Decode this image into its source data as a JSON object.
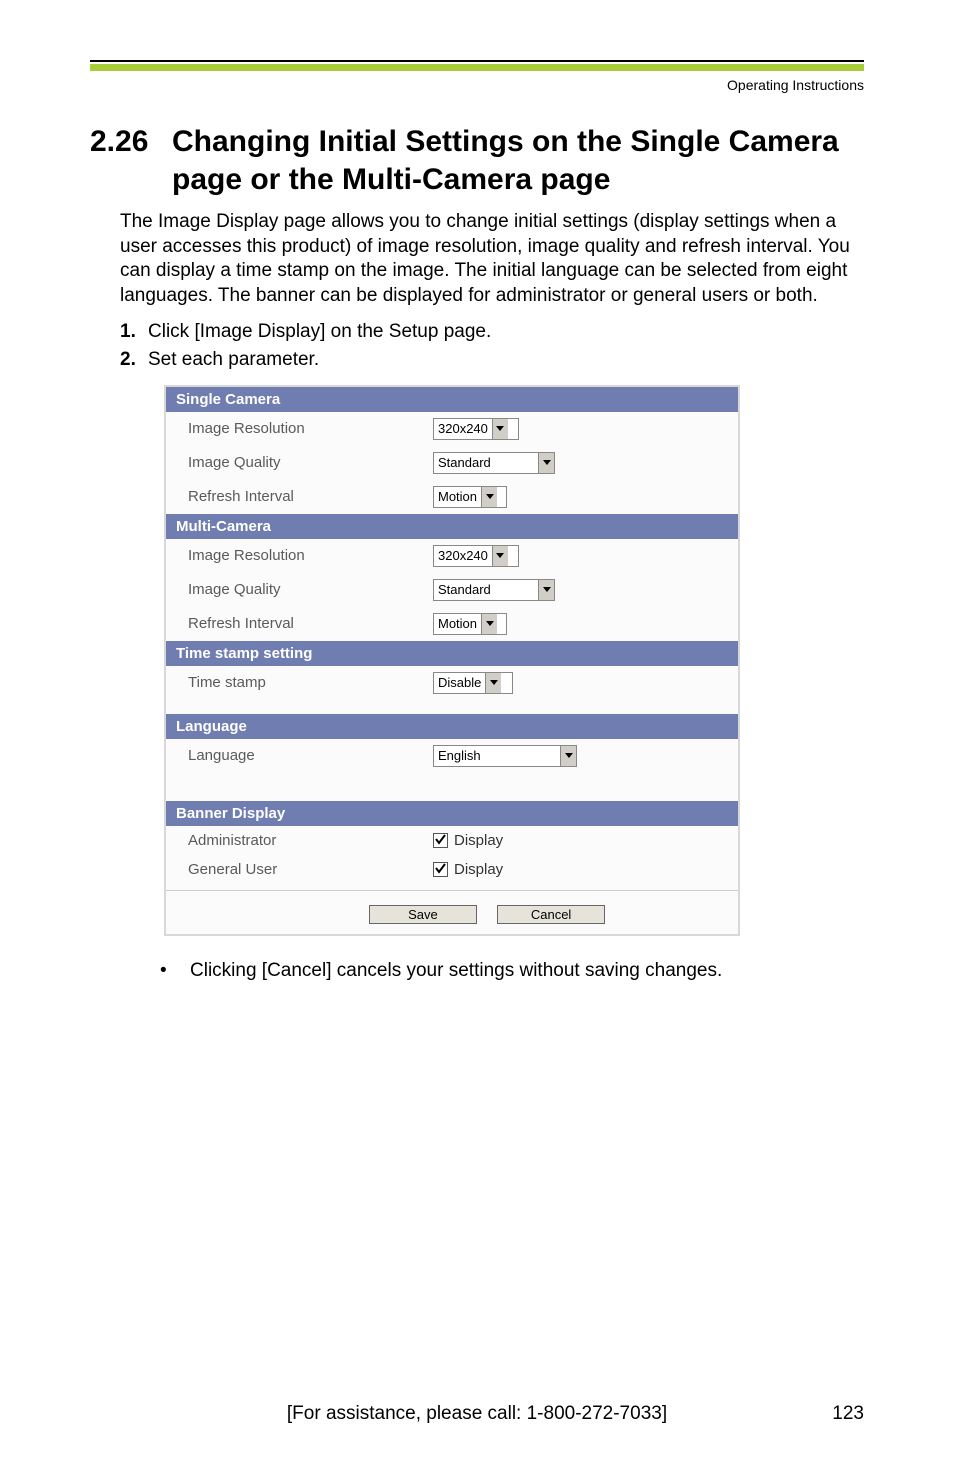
{
  "header": {
    "doc_title": "Operating Instructions"
  },
  "heading": {
    "number": "2.26",
    "title": "Changing Initial Settings on the Single Camera page or the Multi-Camera page"
  },
  "intro": "The Image Display page allows you to change initial settings (display settings when a user accesses this product) of image resolution, image quality and refresh interval. You can display a time stamp on the image. The initial language can be selected from eight languages. The banner can be displayed for administrator or general users or both.",
  "steps": {
    "s1": {
      "num": "1.",
      "text": "Click [Image Display] on the Setup page."
    },
    "s2": {
      "num": "2.",
      "text": "Set each parameter."
    }
  },
  "form": {
    "single_camera": {
      "header": "Single Camera",
      "image_resolution": {
        "label": "Image Resolution",
        "value": "320x240"
      },
      "image_quality": {
        "label": "Image Quality",
        "value": "Standard"
      },
      "refresh_interval": {
        "label": "Refresh Interval",
        "value": "Motion"
      }
    },
    "multi_camera": {
      "header": "Multi-Camera",
      "image_resolution": {
        "label": "Image Resolution",
        "value": "320x240"
      },
      "image_quality": {
        "label": "Image Quality",
        "value": "Standard"
      },
      "refresh_interval": {
        "label": "Refresh Interval",
        "value": "Motion"
      }
    },
    "time_stamp": {
      "header": "Time stamp setting",
      "time_stamp": {
        "label": "Time stamp",
        "value": "Disable"
      }
    },
    "language": {
      "header": "Language",
      "language": {
        "label": "Language",
        "value": "English"
      }
    },
    "banner": {
      "header": "Banner Display",
      "administrator": {
        "label": "Administrator",
        "checkbox_label": "Display"
      },
      "general_user": {
        "label": "General User",
        "checkbox_label": "Display"
      }
    },
    "buttons": {
      "save": "Save",
      "cancel": "Cancel"
    }
  },
  "bullet": "Clicking [Cancel] cancels your settings without saving changes.",
  "footer": {
    "assist": "[For assistance, please call: 1-800-272-7033]",
    "page": "123"
  }
}
